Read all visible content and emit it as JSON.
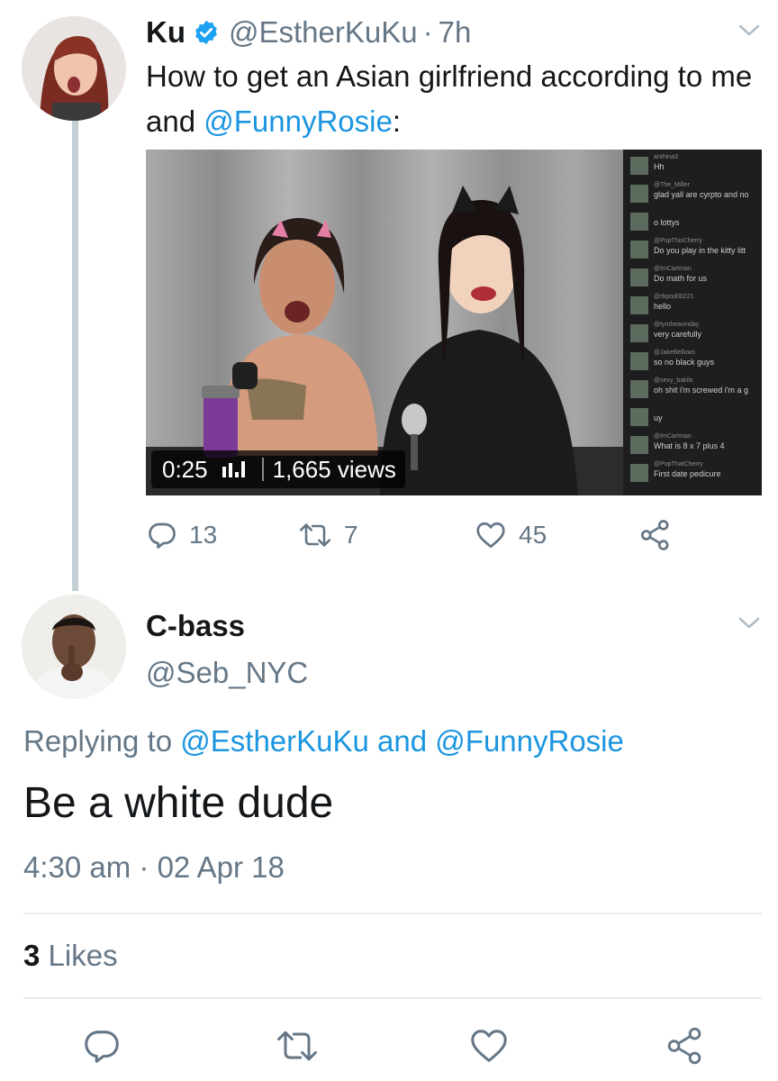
{
  "tweet1": {
    "display_name": "Ku",
    "handle": "@EstherKuKu",
    "separator": "·",
    "time": "7h",
    "text_part1": "How to get an Asian girlfriend according to me and ",
    "mention": "@FunnyRosie",
    "text_part2": ":",
    "video": {
      "duration": "0:25",
      "views": "1,665 views",
      "chat": [
        {
          "user": "anthina3",
          "text": "Hh"
        },
        {
          "user": "@The_Miller",
          "text": "glad yall are cyrpto and no"
        },
        {
          "user": "",
          "text": "o lottys"
        },
        {
          "user": "@PopThisCherry",
          "text": "Do you play in the kitty litt"
        },
        {
          "user": "@ImCartman",
          "text": "Do math for us"
        },
        {
          "user": "@rbpod00221",
          "text": "hello"
        },
        {
          "user": "@tymheavinday",
          "text": "very carefully"
        },
        {
          "user": "@JakeBellows",
          "text": "so no black guys"
        },
        {
          "user": "@sexy_bakilo",
          "text": "oh shit i'm screwed i'm a g"
        },
        {
          "user": "",
          "text": "uy"
        },
        {
          "user": "@ImCartman",
          "text": "What is 8 x 7 plus 4"
        },
        {
          "user": "@PopThatCherry",
          "text": "First date pedicure"
        }
      ]
    },
    "actions": {
      "replies": "13",
      "retweets": "7",
      "likes": "45"
    }
  },
  "tweet2": {
    "display_name": "C-bass",
    "handle": "@Seb_NYC",
    "replying_prefix": "Replying to ",
    "reply_to_1": "@EstherKuKu",
    "reply_and": " and ",
    "reply_to_2": "@FunnyRosie",
    "text": "Be a white dude",
    "timestamp": "4:30 am · 02 Apr 18",
    "likes_count": "3",
    "likes_label": " Likes"
  },
  "colors": {
    "link": "#1b95e0",
    "secondary_text": "#657786",
    "thread_line": "#c4cfd6",
    "divider": "#e6ecf0"
  },
  "icons": [
    "verified-badge-icon",
    "chevron-down-icon",
    "reply-icon",
    "retweet-icon",
    "heart-icon",
    "share-icon",
    "audio-bars-icon"
  ]
}
